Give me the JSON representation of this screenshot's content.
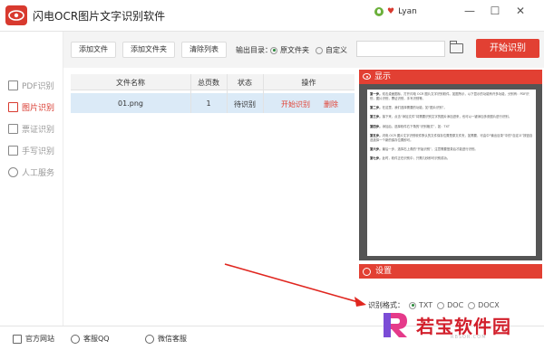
{
  "app": {
    "title": "闪电OCR图片文字识别软件",
    "user_name": "Lyan"
  },
  "window_controls": [
    "—",
    "☐",
    "✕"
  ],
  "sidebar": {
    "items": [
      {
        "label": "PDF识别",
        "icon": "pdf-icon",
        "active": false
      },
      {
        "label": "图片识别",
        "icon": "image-icon",
        "active": true
      },
      {
        "label": "票证识别",
        "icon": "ticket-icon",
        "active": false
      },
      {
        "label": "手写识别",
        "icon": "handwriting-icon",
        "active": false
      },
      {
        "label": "人工服务",
        "icon": "smile-icon",
        "active": false
      }
    ]
  },
  "toolbar": {
    "add_file": "添加文件",
    "add_folder": "添加文件夹",
    "clear_list": "清除列表",
    "output_label": "输出目录：",
    "opt_source": "原文件夹",
    "opt_custom": "自定义",
    "start": "开始识别"
  },
  "table": {
    "headers": [
      "文件名称",
      "总页数",
      "状态",
      "操作"
    ],
    "rows": [
      {
        "name": "01.png",
        "pages": "1",
        "status": "待识别",
        "action_start": "开始识别",
        "action_delete": "删除"
      }
    ]
  },
  "preview": {
    "title": "显示",
    "paragraphs": [
      {
        "lead": "第一步，",
        "text": "双击桌面图标，打开闪电 OCR 图片文字识别软件。如图所示，以下显示的功能有许多功能，分别有：PDF识别，图片识别，票证识别，手写识别等。"
      },
      {
        "lead": "第二步，",
        "text": "在这里，我们选择需要的功能，如“图片识别”。"
      },
      {
        "lead": "第三步，",
        "text": "接下来，点击“添加文件”将需要识别文字的图片添加进来，也可以一键添加多张图片进行识别。"
      },
      {
        "lead": "第四步，",
        "text": "添加后，选择软件右下角的“识别格式”，如：TXT"
      },
      {
        "lead": "第五步，",
        "text": "闪电 OCR 图片文字识别软件默认的文件保存位置是原文件夹，如需要，可由中“输出目录”中的“自定义”按钮自选选择一个新的保存位置即可。"
      },
      {
        "lead": "第六步，",
        "text": "最后一步，选择右上角的“开始识别”，注意需要登录后才能进行识别。"
      },
      {
        "lead": "第七步，",
        "text": "此时，软件正在识别中，只需几秒即可识别成功。"
      }
    ]
  },
  "settings": {
    "title": "设置",
    "format_label": "识别格式：",
    "formats": [
      "TXT",
      "DOC",
      "DOCX"
    ],
    "selected_format": "TXT"
  },
  "footer": {
    "items": [
      "官方网站",
      "客服QQ",
      "微信客服"
    ]
  },
  "watermark": {
    "text": "若宝软件园",
    "url": "RBSOR.COM"
  },
  "colors": {
    "accent": "#e24033",
    "selected_row": "#dbeaf7",
    "radio_on": "#2a8a3a"
  }
}
